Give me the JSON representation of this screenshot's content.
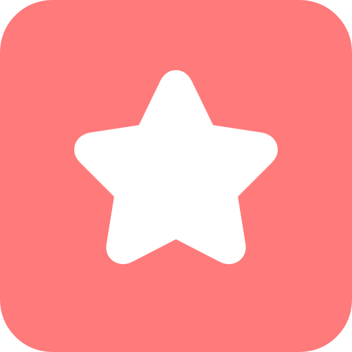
{
  "icon": {
    "name": "star-icon",
    "background_color": "#FF7A7A",
    "glyph_color": "#FFFFFF"
  }
}
